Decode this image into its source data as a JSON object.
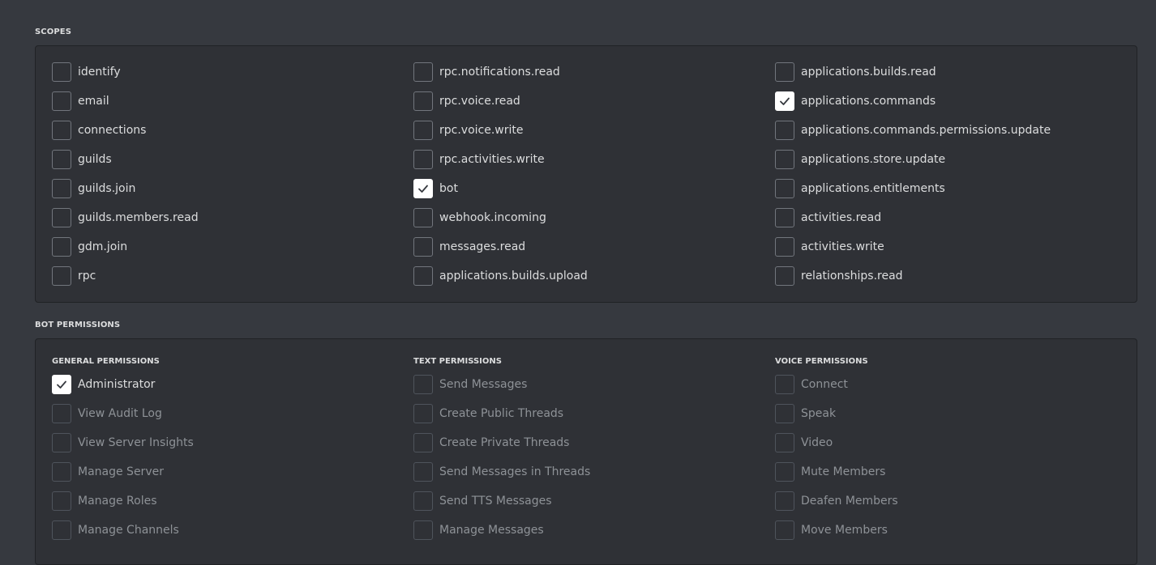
{
  "scopes": {
    "title": "SCOPES",
    "columns": [
      [
        {
          "label": "identify",
          "checked": false
        },
        {
          "label": "email",
          "checked": false
        },
        {
          "label": "connections",
          "checked": false
        },
        {
          "label": "guilds",
          "checked": false
        },
        {
          "label": "guilds.join",
          "checked": false
        },
        {
          "label": "guilds.members.read",
          "checked": false
        },
        {
          "label": "gdm.join",
          "checked": false
        },
        {
          "label": "rpc",
          "checked": false
        }
      ],
      [
        {
          "label": "rpc.notifications.read",
          "checked": false
        },
        {
          "label": "rpc.voice.read",
          "checked": false
        },
        {
          "label": "rpc.voice.write",
          "checked": false
        },
        {
          "label": "rpc.activities.write",
          "checked": false
        },
        {
          "label": "bot",
          "checked": true
        },
        {
          "label": "webhook.incoming",
          "checked": false
        },
        {
          "label": "messages.read",
          "checked": false
        },
        {
          "label": "applications.builds.upload",
          "checked": false
        }
      ],
      [
        {
          "label": "applications.builds.read",
          "checked": false
        },
        {
          "label": "applications.commands",
          "checked": true
        },
        {
          "label": "applications.commands.permissions.update",
          "checked": false
        },
        {
          "label": "applications.store.update",
          "checked": false
        },
        {
          "label": "applications.entitlements",
          "checked": false
        },
        {
          "label": "activities.read",
          "checked": false
        },
        {
          "label": "activities.write",
          "checked": false
        },
        {
          "label": "relationships.read",
          "checked": false
        }
      ]
    ]
  },
  "bot_permissions": {
    "title": "BOT PERMISSIONS",
    "groups": [
      {
        "heading": "GENERAL PERMISSIONS",
        "items": [
          {
            "label": "Administrator",
            "checked": true,
            "disabled": false
          },
          {
            "label": "View Audit Log",
            "checked": false,
            "disabled": true
          },
          {
            "label": "View Server Insights",
            "checked": false,
            "disabled": true
          },
          {
            "label": "Manage Server",
            "checked": false,
            "disabled": true
          },
          {
            "label": "Manage Roles",
            "checked": false,
            "disabled": true
          },
          {
            "label": "Manage Channels",
            "checked": false,
            "disabled": true
          }
        ]
      },
      {
        "heading": "TEXT PERMISSIONS",
        "items": [
          {
            "label": "Send Messages",
            "checked": false,
            "disabled": true
          },
          {
            "label": "Create Public Threads",
            "checked": false,
            "disabled": true
          },
          {
            "label": "Create Private Threads",
            "checked": false,
            "disabled": true
          },
          {
            "label": "Send Messages in Threads",
            "checked": false,
            "disabled": true
          },
          {
            "label": "Send TTS Messages",
            "checked": false,
            "disabled": true
          },
          {
            "label": "Manage Messages",
            "checked": false,
            "disabled": true
          }
        ]
      },
      {
        "heading": "VOICE PERMISSIONS",
        "items": [
          {
            "label": "Connect",
            "checked": false,
            "disabled": true
          },
          {
            "label": "Speak",
            "checked": false,
            "disabled": true
          },
          {
            "label": "Video",
            "checked": false,
            "disabled": true
          },
          {
            "label": "Mute Members",
            "checked": false,
            "disabled": true
          },
          {
            "label": "Deafen Members",
            "checked": false,
            "disabled": true
          },
          {
            "label": "Move Members",
            "checked": false,
            "disabled": true
          }
        ]
      }
    ]
  },
  "icons": {
    "check": "checkmark-icon"
  }
}
